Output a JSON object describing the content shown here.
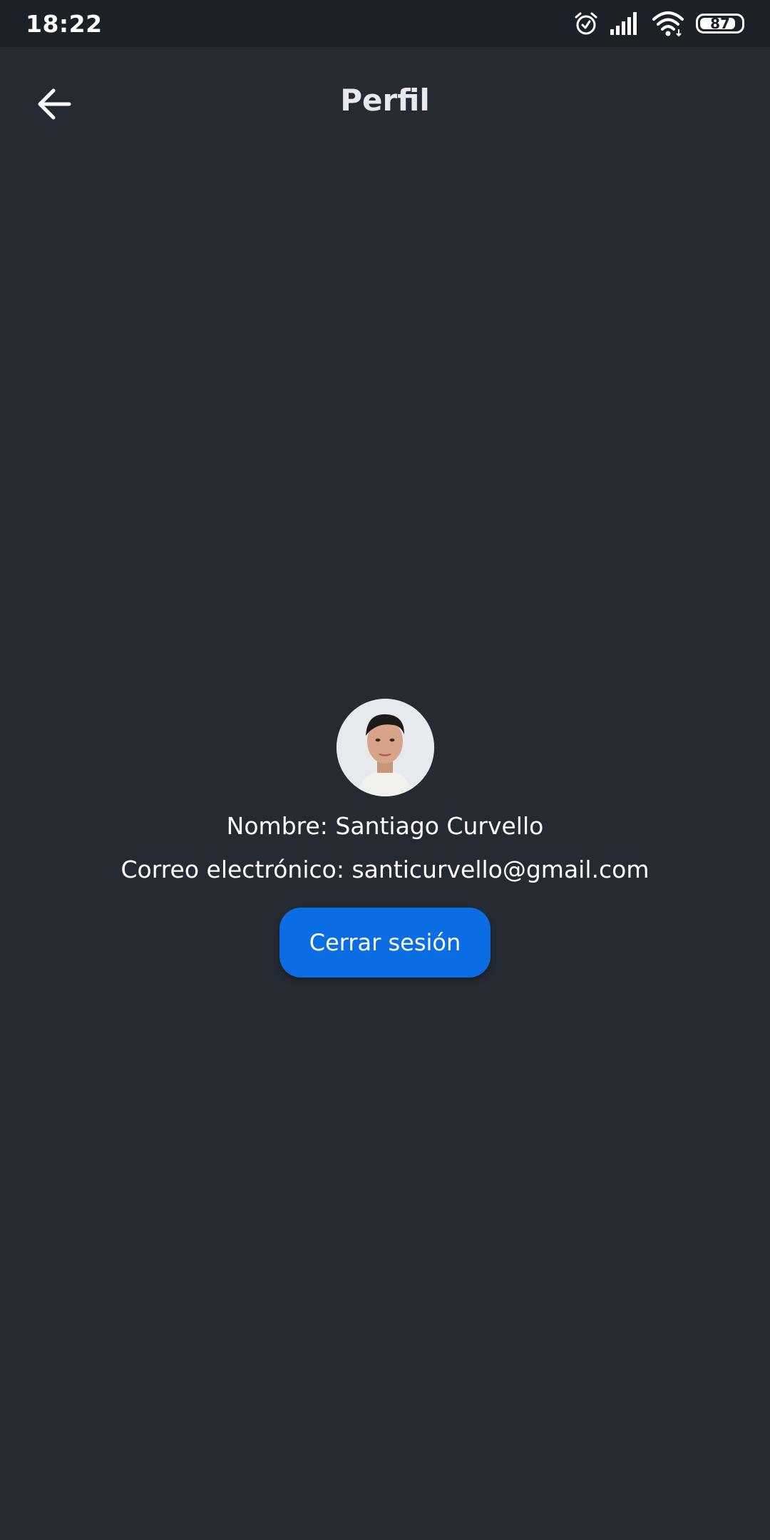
{
  "status_bar": {
    "time": "18:22",
    "battery_level": "87",
    "battery_fraction": 0.87,
    "icons": [
      "alarm-icon",
      "signal-icon",
      "wifi-icon",
      "battery-icon"
    ]
  },
  "app_bar": {
    "title": "Perfil",
    "back_icon": "arrow-left-icon"
  },
  "profile": {
    "name_line": "Nombre: Santiago Curvello",
    "email_line": "Correo electrónico: santicurvello@gmail.com",
    "logout_label": "Cerrar sesión"
  },
  "colors": {
    "background": "#262b33",
    "status_bar": "#1c2027",
    "accent_button": "#0b6de3",
    "text": "#ffffff"
  }
}
